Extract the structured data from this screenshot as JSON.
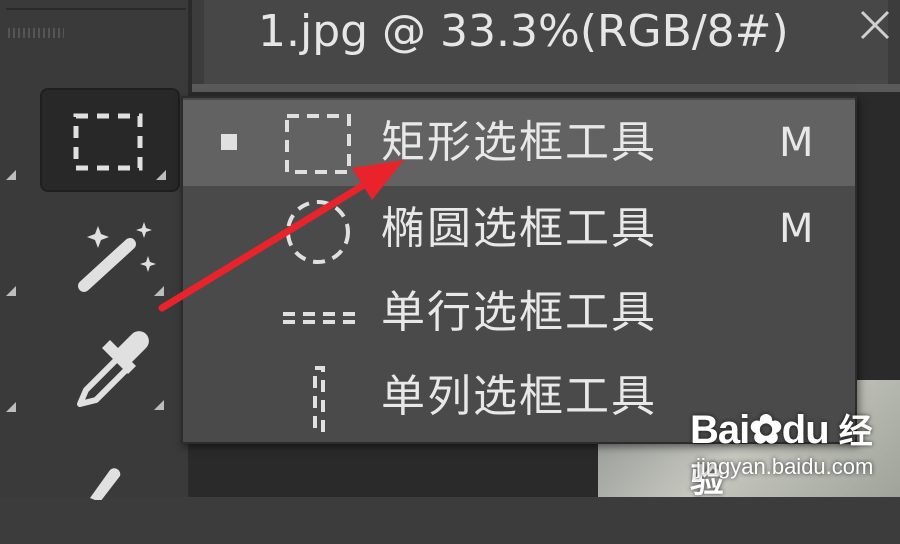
{
  "document": {
    "title": "1.jpg @ 33.3%(RGB/8#)"
  },
  "toolbar": {
    "tools": [
      {
        "icon": "rectangular-marquee-icon"
      },
      {
        "icon": "magic-wand-icon"
      },
      {
        "icon": "eyedropper-icon"
      },
      {
        "icon": "brush-icon"
      }
    ]
  },
  "menu": {
    "items": [
      {
        "label": "矩形选框工具",
        "shortcut": "M",
        "icon": "rectangular-marquee-icon",
        "selected": true
      },
      {
        "label": "椭圆选框工具",
        "shortcut": "M",
        "icon": "elliptical-marquee-icon",
        "selected": false
      },
      {
        "label": "单行选框工具",
        "shortcut": "",
        "icon": "single-row-marquee-icon",
        "selected": false
      },
      {
        "label": "单列选框工具",
        "shortcut": "",
        "icon": "single-column-marquee-icon",
        "selected": false
      }
    ]
  },
  "annotation": {
    "color": "#e8232b"
  },
  "watermark": {
    "logo_text": "Bai",
    "logo_text_2": "du",
    "logo_cn": "经验",
    "url": "jingyan.baidu.com"
  }
}
